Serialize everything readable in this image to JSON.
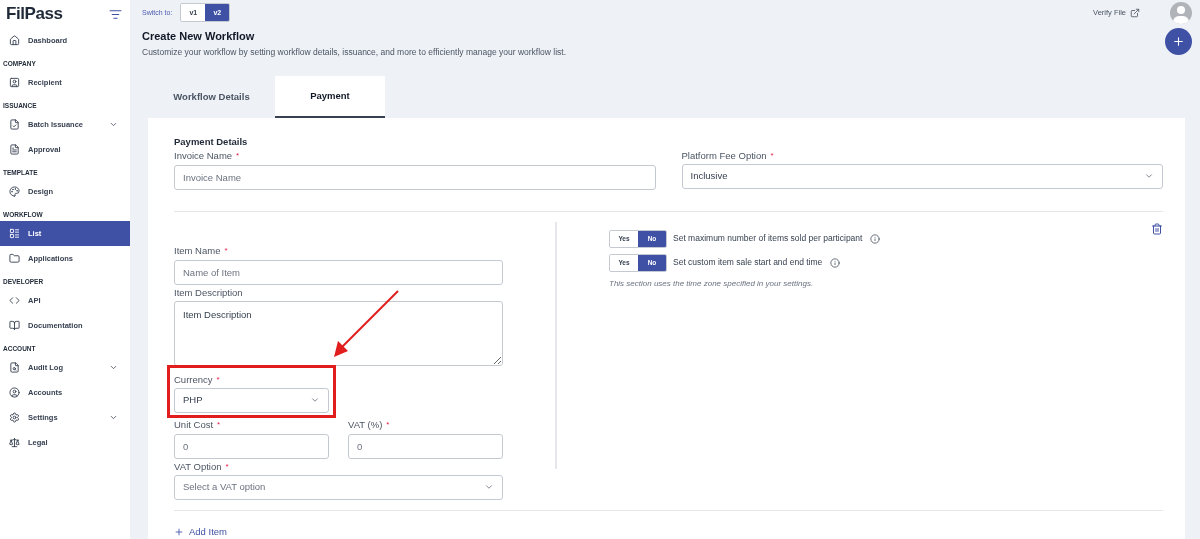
{
  "sidebar": {
    "logo": "FilPass",
    "sections": [
      {
        "items": [
          {
            "label": "Dashboard",
            "selected": false
          }
        ]
      },
      {
        "heading": "COMPANY",
        "items": [
          {
            "label": "Recipient",
            "selected": false
          }
        ]
      },
      {
        "heading": "ISSUANCE",
        "items": [
          {
            "label": "Batch Issuance",
            "selected": false,
            "has_submenu": true
          },
          {
            "label": "Approval",
            "selected": false
          }
        ]
      },
      {
        "heading": "TEMPLATE",
        "items": [
          {
            "label": "Design",
            "selected": false
          }
        ]
      },
      {
        "heading": "WORKFLOW",
        "items": [
          {
            "label": "List",
            "selected": true
          },
          {
            "label": "Applications",
            "selected": false
          }
        ]
      },
      {
        "heading": "DEVELOPER",
        "items": [
          {
            "label": "API",
            "selected": false
          },
          {
            "label": "Documentation",
            "selected": false
          }
        ]
      },
      {
        "heading": "ACCOUNT",
        "items": [
          {
            "label": "Audit Log",
            "selected": false,
            "has_submenu": true
          },
          {
            "label": "Accounts",
            "selected": false
          },
          {
            "label": "Settings",
            "selected": false,
            "has_submenu": true
          },
          {
            "label": "Legal",
            "selected": false
          }
        ]
      }
    ]
  },
  "topbar": {
    "switch_label": "Switch to:",
    "versions": [
      {
        "label": "v1",
        "selected": false
      },
      {
        "label": "v2",
        "selected": true
      }
    ],
    "verify_link": "Verify File"
  },
  "page": {
    "title": "Create New Workflow",
    "subtitle": "Customize your workflow by setting workflow details, issuance, and more to efficiently manage your workflow list."
  },
  "tabs": [
    {
      "label": "Workflow Details",
      "selected": false
    },
    {
      "label": "Payment",
      "selected": true
    }
  ],
  "payment": {
    "heading": "Payment Details",
    "invoice_name": {
      "label": "Invoice Name",
      "required": "*",
      "placeholder": "Invoice Name"
    },
    "platform_fee": {
      "label": "Platform Fee Option",
      "required": "*",
      "value": "Inclusive"
    },
    "item": {
      "item_name": {
        "label": "Item Name",
        "required": "*",
        "placeholder": "Name of Item"
      },
      "item_description": {
        "label": "Item Description",
        "placeholder": "Item Description"
      },
      "currency": {
        "label": "Currency",
        "required": "*",
        "value": "PHP",
        "highlighted": true
      },
      "unit_cost": {
        "label": "Unit Cost",
        "required": "*",
        "placeholder": "0"
      },
      "vat_percent": {
        "label": "VAT (%)",
        "required": "*",
        "placeholder": "0"
      },
      "vat_option": {
        "label": "VAT Option",
        "required": "*",
        "placeholder": "Select a VAT option"
      },
      "toggles": [
        {
          "label": "Set maximum number of items sold per participant",
          "options": [
            {
              "label": "Yes",
              "selected": false
            },
            {
              "label": "No",
              "selected": true
            }
          ]
        },
        {
          "label": "Set custom item sale start and end time",
          "options": [
            {
              "label": "Yes",
              "selected": false
            },
            {
              "label": "No",
              "selected": true
            }
          ]
        }
      ],
      "note": "This section uses the time zone specified in your settings."
    },
    "add_item": "Add Item"
  }
}
